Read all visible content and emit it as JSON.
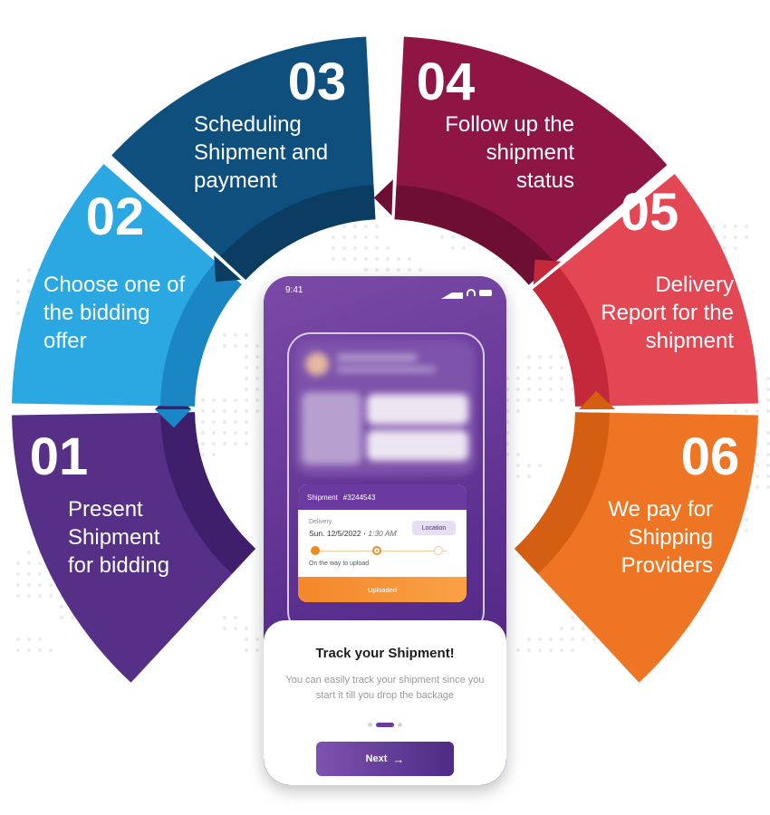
{
  "segments": [
    {
      "number": "01",
      "lines": [
        "Present",
        "Shipment",
        "for bidding"
      ],
      "color": "#563087",
      "dark": "#3f1f6c"
    },
    {
      "number": "02",
      "lines": [
        "Choose one of",
        "the bidding",
        "offer"
      ],
      "color": "#2ba8e2",
      "dark": "#1a86c4"
    },
    {
      "number": "03",
      "lines": [
        "Scheduling",
        "Shipment and",
        "payment"
      ],
      "color": "#0f4f7e",
      "dark": "#0b3c62"
    },
    {
      "number": "04",
      "lines": [
        "Follow up the",
        "shipment",
        "status"
      ],
      "color": "#8e1544",
      "dark": "#6e0e33"
    },
    {
      "number": "05",
      "lines": [
        "Delivery",
        "Report for the",
        "shipment"
      ],
      "color": "#e24753",
      "dark": "#c3293a"
    },
    {
      "number": "06",
      "lines": [
        "We pay for",
        "Shipping",
        "Providers"
      ],
      "color": "#ee7524",
      "dark": "#d45e12"
    }
  ],
  "phone": {
    "status_time": "9:41",
    "card": {
      "shipment_label": "Shipment",
      "shipment_id": "#3244543",
      "delivery_label": "Delivery",
      "delivery_date": "Sun. 12/5/2022",
      "delivery_time": "1:30 AM",
      "location_button": "Location",
      "status_text": "On the way to upload",
      "upload_label": "Uploaded"
    },
    "sheet": {
      "title": "Track your Shipment!",
      "description": "You can easily track your shipment since you start it till you drop the backage",
      "next_label": "Next",
      "next_arrow": "→"
    }
  }
}
